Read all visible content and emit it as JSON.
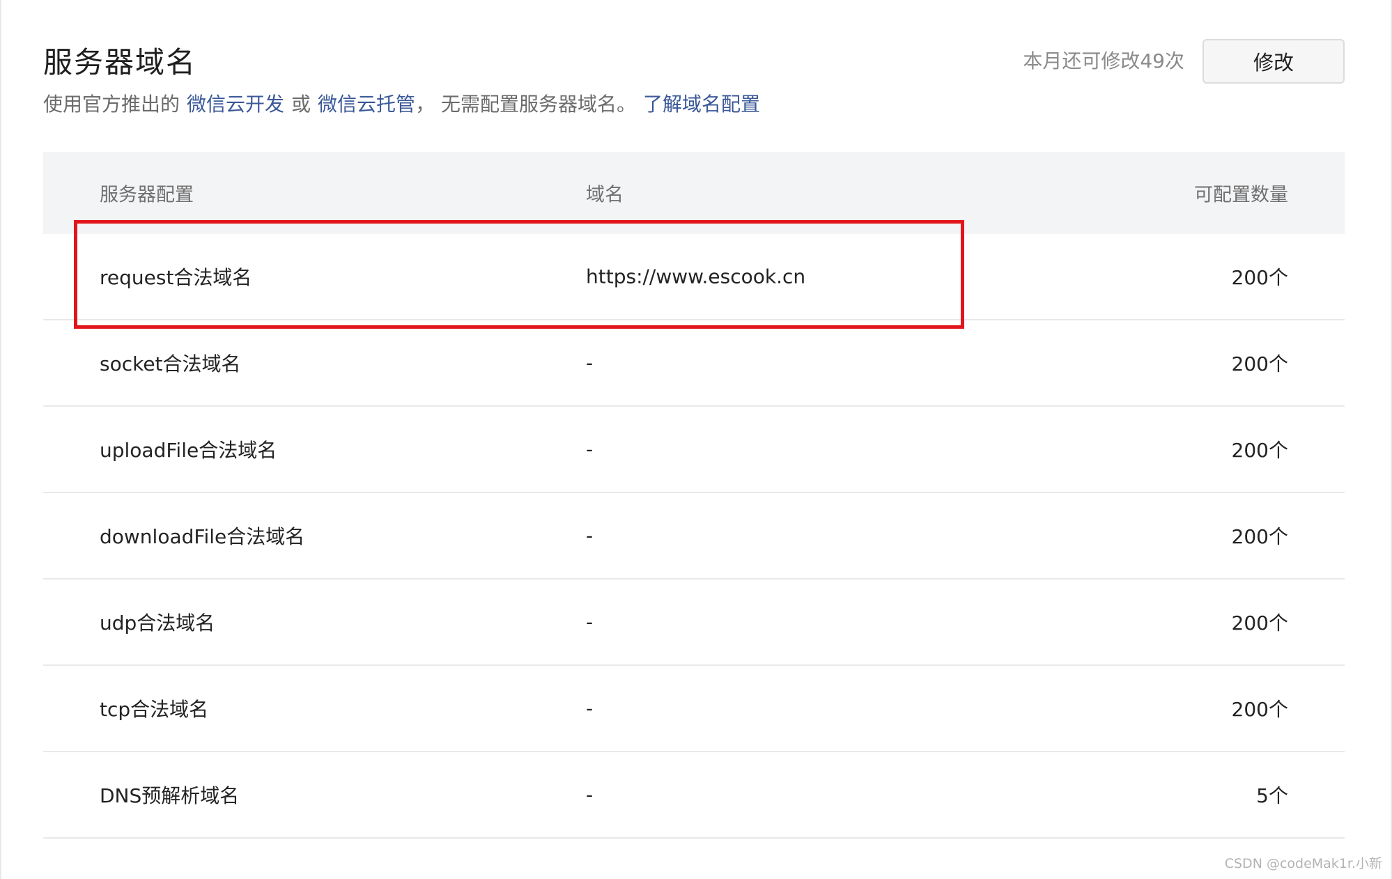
{
  "header": {
    "title": "服务器域名",
    "quota_text": "本月还可修改49次",
    "edit_button_label": "修改"
  },
  "description": {
    "prefix": "使用官方推出的",
    "link_cloud_dev": "微信云开发",
    "conjunction": "或",
    "link_cloud_hosting": "微信云托管",
    "suffix": "， 无需配置服务器域名。",
    "link_learn_more": "了解域名配置"
  },
  "table": {
    "columns": [
      "服务器配置",
      "域名",
      "可配置数量"
    ],
    "rows": [
      {
        "config": "request合法域名",
        "domain": "https://www.escook.cn",
        "count": "200个"
      },
      {
        "config": "socket合法域名",
        "domain": "-",
        "count": "200个"
      },
      {
        "config": "uploadFile合法域名",
        "domain": "-",
        "count": "200个"
      },
      {
        "config": "downloadFile合法域名",
        "domain": "-",
        "count": "200个"
      },
      {
        "config": "udp合法域名",
        "domain": "-",
        "count": "200个"
      },
      {
        "config": "tcp合法域名",
        "domain": "-",
        "count": "200个"
      },
      {
        "config": "DNS预解析域名",
        "domain": "-",
        "count": "5个"
      }
    ]
  },
  "annotation": {
    "highlight_color": "#e2151c"
  },
  "watermark": "CSDN @codeMak1r.小新",
  "colors": {
    "link": "#3b5998",
    "header_bg": "#f3f4f6"
  }
}
